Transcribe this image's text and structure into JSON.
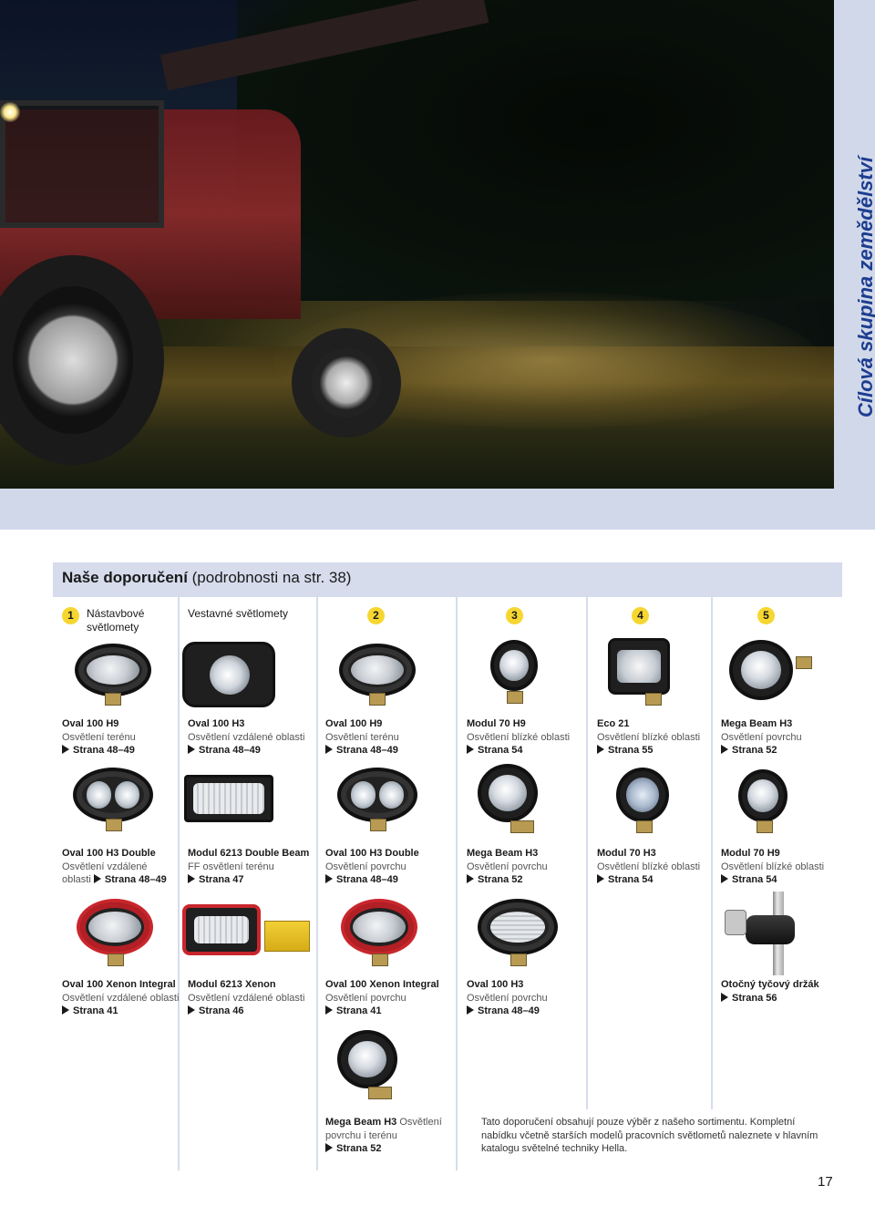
{
  "side_title": "Cílová skupina zemědělství",
  "panel": {
    "title_bold": "Naše doporučení",
    "title_rest": " (podrobnosti na str. 38)"
  },
  "header": {
    "col1_number": "1",
    "col1_label": "Nástavbové světlomety",
    "col2_label": "Vestavné světlomety",
    "col3_number": "2",
    "col4_number": "3",
    "col5_number": "4",
    "col6_number": "5"
  },
  "rows": [
    [
      {
        "name": "Oval 100 H9",
        "desc": "Osvětlení terénu",
        "ref": "Strana 48–49"
      },
      {
        "name": "Oval 100 H3",
        "desc": "Osvětlení vzdálené oblasti",
        "ref": "Strana 48–49"
      },
      {
        "name": "Oval 100 H9",
        "desc": "Osvětlení terénu",
        "ref": "Strana 48–49"
      },
      {
        "name": "Modul 70 H9",
        "desc": "Osvětlení blízké oblasti",
        "ref": "Strana 54"
      },
      {
        "name": "Eco 21",
        "desc": "Osvětlení blízké oblasti",
        "ref": "Strana 55"
      },
      {
        "name": "Mega Beam H3",
        "desc": "Osvětlení povrchu",
        "ref": "Strana 52"
      }
    ],
    [
      {
        "name": "Oval 100 H3 Double",
        "desc": "Osvětlení vzdálené oblasti",
        "ref": "Strana 48–49"
      },
      {
        "name": "Modul 6213 Double Beam",
        "desc": "FF osvětlení terénu",
        "ref": "Strana 47"
      },
      {
        "name": "Oval 100 H3 Double",
        "desc": "Osvětlení povrchu",
        "ref": "Strana 48–49"
      },
      {
        "name": "Mega Beam H3",
        "desc": "Osvětlení povrchu",
        "ref": "Strana 52"
      },
      {
        "name": "Modul 70 H3",
        "desc": "Osvětlení blízké oblasti",
        "ref": "Strana 54"
      },
      {
        "name": "Modul 70 H9",
        "desc": "Osvětlení blízké oblasti",
        "ref": "Strana 54"
      }
    ],
    [
      {
        "name": "Oval 100 Xenon Integral",
        "desc": "Osvětlení vzdálené oblasti",
        "ref": "Strana 41"
      },
      {
        "name": "Modul 6213 Xenon",
        "desc": "Osvětlení vzdálené oblasti",
        "ref": "Strana 46"
      },
      {
        "name": "Oval 100 Xenon Integral",
        "desc": "Osvětlení povrchu",
        "ref": "Strana 41"
      },
      {
        "name": "Oval 100 H3",
        "desc": "Osvětlení povrchu",
        "ref": "Strana 48–49"
      },
      {
        "name": "Otočný tyčový držák",
        "desc": "",
        "ref": "Strana 56"
      }
    ],
    [
      {
        "name": "Mega Beam H3",
        "desc": "Osvětlení povrchu i terénu",
        "ref": "Strana 52"
      }
    ]
  ],
  "footer_note": "Tato doporučení obsahují pouze výběr z našeho sortimentu. Kompletní nabídku včetně starších modelů pracovních světlometů naleznete v hlavním katalogu světelné techniky Hella.",
  "page_number": "17"
}
